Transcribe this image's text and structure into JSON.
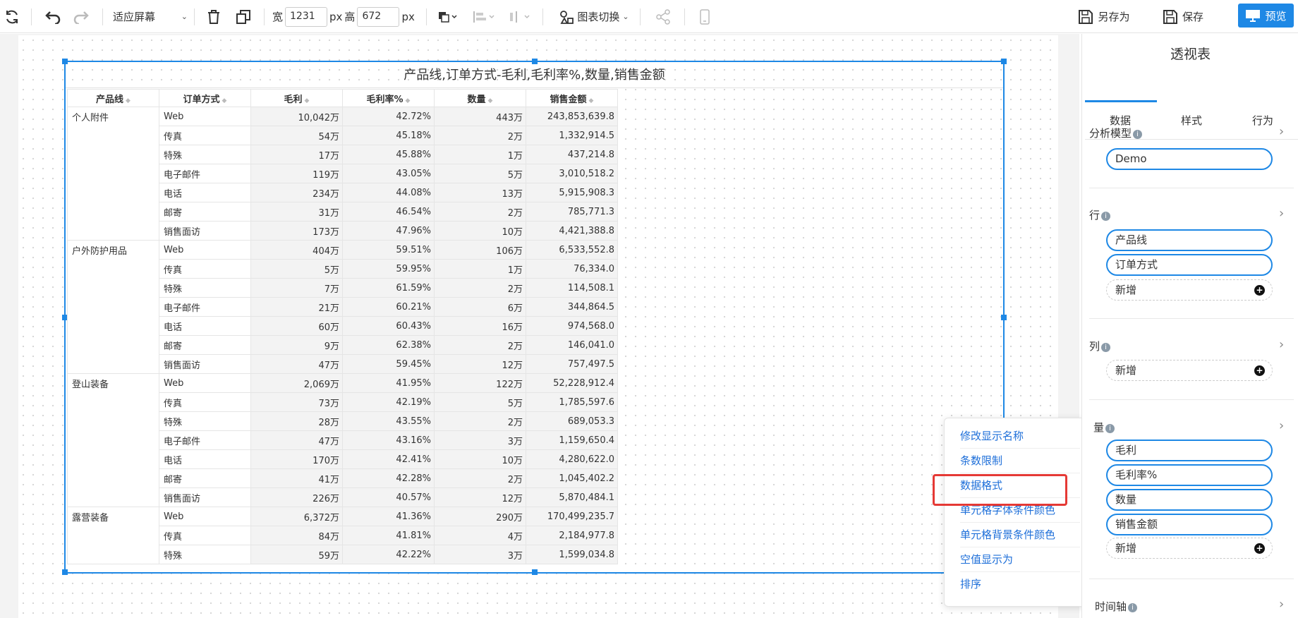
{
  "toolbar": {
    "fit_screen": "适应屏幕",
    "width_label": "宽",
    "width_value": "1231",
    "px1": "px",
    "height_label": "高",
    "height_value": "672",
    "px2": "px",
    "chart_switch": "图表切换",
    "save_as": "另存为",
    "save": "保存",
    "preview": "预览",
    "accent": "#1e88e5"
  },
  "pivot": {
    "title": "产品线,订单方式-毛利,毛利率%,数量,销售金额",
    "headers": [
      "产品线",
      "订单方式",
      "毛利",
      "毛利率%",
      "数量",
      "销售金额"
    ],
    "groups": [
      {
        "name": "个人附件",
        "rows": [
          [
            "Web",
            "10,042万",
            "42.72%",
            "443万",
            "243,853,639.8"
          ],
          [
            "传真",
            "54万",
            "45.18%",
            "2万",
            "1,332,914.5"
          ],
          [
            "特殊",
            "17万",
            "45.88%",
            "1万",
            "437,214.8"
          ],
          [
            "电子邮件",
            "119万",
            "43.05%",
            "5万",
            "3,010,518.2"
          ],
          [
            "电话",
            "234万",
            "44.08%",
            "13万",
            "5,915,908.3"
          ],
          [
            "邮寄",
            "31万",
            "46.54%",
            "2万",
            "785,771.3"
          ],
          [
            "销售面访",
            "173万",
            "47.96%",
            "10万",
            "4,421,388.8"
          ]
        ]
      },
      {
        "name": "户外防护用品",
        "rows": [
          [
            "Web",
            "404万",
            "59.51%",
            "106万",
            "6,533,552.8"
          ],
          [
            "传真",
            "5万",
            "59.95%",
            "1万",
            "76,334.0"
          ],
          [
            "特殊",
            "7万",
            "61.59%",
            "2万",
            "114,508.1"
          ],
          [
            "电子邮件",
            "21万",
            "60.21%",
            "6万",
            "344,864.5"
          ],
          [
            "电话",
            "60万",
            "60.43%",
            "16万",
            "974,568.0"
          ],
          [
            "邮寄",
            "9万",
            "62.38%",
            "2万",
            "146,041.0"
          ],
          [
            "销售面访",
            "47万",
            "59.45%",
            "12万",
            "757,497.5"
          ]
        ]
      },
      {
        "name": "登山装备",
        "rows": [
          [
            "Web",
            "2,069万",
            "41.95%",
            "122万",
            "52,228,912.4"
          ],
          [
            "传真",
            "73万",
            "42.19%",
            "5万",
            "1,785,597.6"
          ],
          [
            "特殊",
            "28万",
            "43.55%",
            "2万",
            "689,053.3"
          ],
          [
            "电子邮件",
            "47万",
            "43.16%",
            "3万",
            "1,159,650.4"
          ],
          [
            "电话",
            "170万",
            "42.41%",
            "10万",
            "4,280,622.0"
          ],
          [
            "邮寄",
            "41万",
            "42.28%",
            "2万",
            "1,045,402.2"
          ],
          [
            "销售面访",
            "226万",
            "40.57%",
            "12万",
            "5,870,484.1"
          ]
        ]
      },
      {
        "name": "露营装备",
        "rows": [
          [
            "Web",
            "6,372万",
            "41.36%",
            "290万",
            "170,499,235.7"
          ],
          [
            "传真",
            "84万",
            "41.81%",
            "4万",
            "2,184,977.8"
          ],
          [
            "特殊",
            "59万",
            "42.22%",
            "3万",
            "1,599,034.8"
          ]
        ]
      }
    ]
  },
  "panel": {
    "title": "透视表",
    "tabs": [
      "数据",
      "样式",
      "行为"
    ],
    "model_label": "分析模型",
    "model_value": "Demo",
    "rows_label": "行",
    "rows": [
      "产品线",
      "订单方式"
    ],
    "add": "新增",
    "cols_label": "列",
    "measures_label": "量",
    "measures": [
      "毛利",
      "毛利率%",
      "数量",
      "销售金额"
    ],
    "time_label": "时间轴"
  },
  "context_menu": {
    "items": [
      "修改显示名称",
      "条数限制",
      "数据格式",
      "单元格字体条件颜色",
      "单元格背景条件颜色",
      "空值显示为",
      "排序"
    ]
  }
}
